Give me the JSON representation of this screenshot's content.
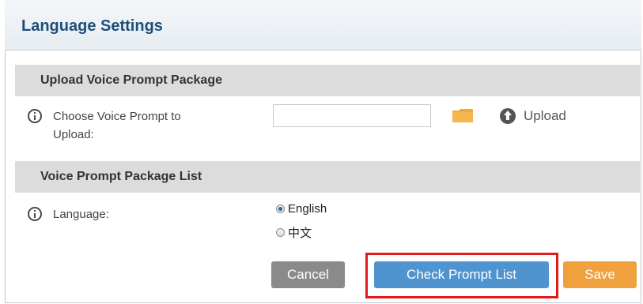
{
  "page": {
    "title": "Language Settings"
  },
  "upload_section": {
    "header": "Upload Voice Prompt Package",
    "choose_label_line1": "Choose Voice Prompt to",
    "choose_label_line2": "Upload:",
    "file_value": "",
    "upload_label": "Upload"
  },
  "list_section": {
    "header": "Voice Prompt Package List",
    "language_label": "Language:",
    "options": [
      {
        "label": "English",
        "checked": true
      },
      {
        "label": "中文",
        "checked": false
      }
    ]
  },
  "actions": {
    "cancel_label": "Cancel",
    "check_label": "Check Prompt List",
    "save_label": "Save"
  },
  "colors": {
    "title": "#1f4e79",
    "cancel": "#8a8a8a",
    "check": "#4f94cf",
    "save": "#f0a03c",
    "highlight": "#e01b1b"
  }
}
